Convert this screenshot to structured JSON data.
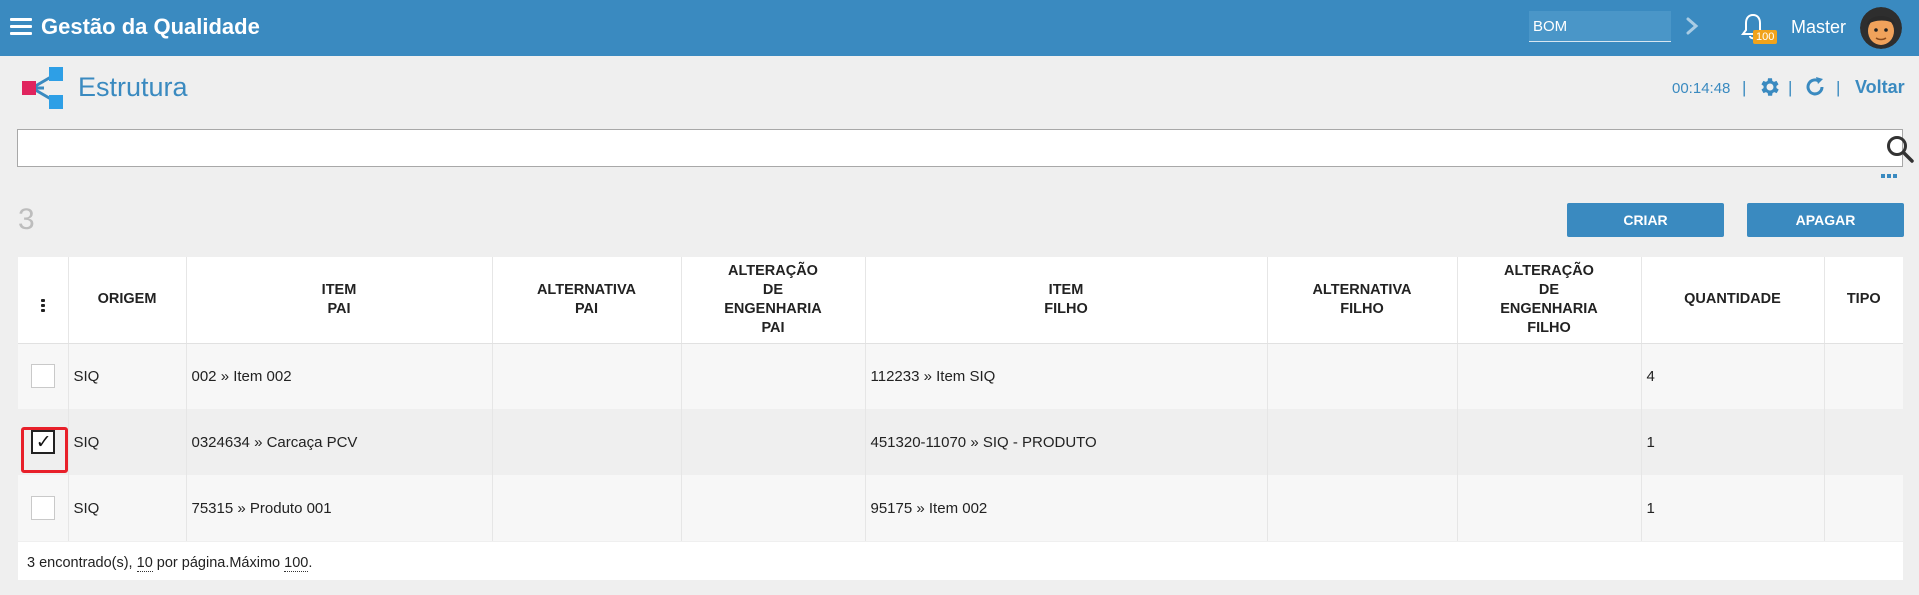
{
  "header": {
    "app_title": "Gestão da Qualidade",
    "bom_value": "BOM",
    "notification_count": "100",
    "user_name": "Master"
  },
  "page": {
    "title": "Estrutura",
    "timer": "00:14:48",
    "back_label": "Voltar",
    "separator": "|"
  },
  "search": {
    "placeholder": "",
    "value": ""
  },
  "toolbar": {
    "count": "3",
    "create_label": "CRIAR",
    "delete_label": "APAGAR"
  },
  "table": {
    "columns": [
      "",
      "ORIGEM",
      "ITEM\nPAI",
      "ALTERNATIVA\nPAI",
      "ALTERAÇÃO\nDE\nENGENHARIA\nPAI",
      "ITEM\nFILHO",
      "ALTERNATIVA\nFILHO",
      "ALTERAÇÃO\nDE\nENGENHARIA\nFILHO",
      "QUANTIDADE",
      "TIPO"
    ],
    "rows": [
      {
        "checked": false,
        "origem": "SIQ",
        "item_pai": "002 » Item 002",
        "alt_pai": "",
        "alt_eng_pai": "",
        "item_filho": "112233 » Item SIQ",
        "alt_filho": "",
        "alt_eng_filho": "",
        "quantidade": "4",
        "tipo": ""
      },
      {
        "checked": true,
        "origem": "SIQ",
        "item_pai": "0324634 » Carcaça PCV",
        "alt_pai": "",
        "alt_eng_pai": "",
        "item_filho": "451320-11070 » SIQ - PRODUTO",
        "alt_filho": "",
        "alt_eng_filho": "",
        "quantidade": "1",
        "tipo": ""
      },
      {
        "checked": false,
        "origem": "SIQ",
        "item_pai": "75315 » Produto 001",
        "alt_pai": "",
        "alt_eng_pai": "",
        "item_filho": "95175 » Item 002",
        "alt_filho": "",
        "alt_eng_filho": "",
        "quantidade": "1",
        "tipo": ""
      }
    ]
  },
  "footer": {
    "found_text": "3 encontrado(s), ",
    "per_page_value": "10",
    "per_page_text": " por página.Máximo ",
    "max_value": "100",
    "end_text": "."
  },
  "colors": {
    "brand": "#3a8ac0",
    "badge": "#f1a31b",
    "highlight": "#e8202a"
  }
}
